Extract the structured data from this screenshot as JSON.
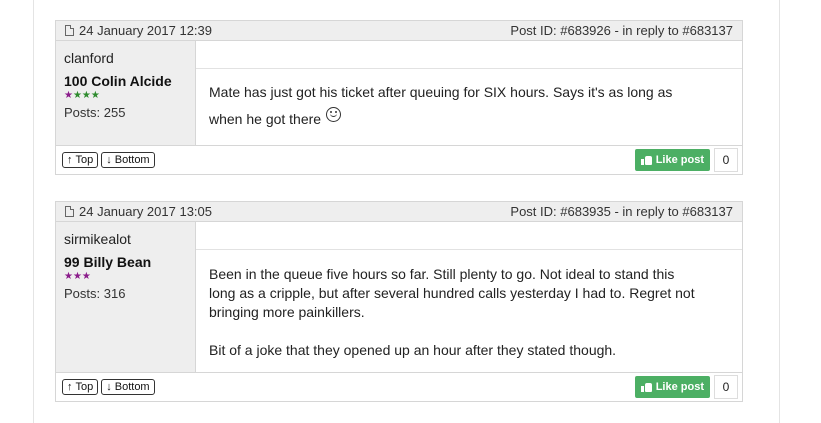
{
  "posts": [
    {
      "date": "24 January 2017 12:39",
      "post_ref": "Post ID: #683926 - in reply to #683137",
      "username": "clanford",
      "profile_name": "100 Colin Alcide",
      "stars": "★★★★",
      "posts_count": "Posts: 255",
      "message_lines": [
        "Mate has just got his ticket after queuing for SIX hours. Says it's as long as",
        "when he got there"
      ],
      "top_label": "Top",
      "bottom_label": "Bottom",
      "like_label": "Like post",
      "like_count": "0"
    },
    {
      "date": "24 January 2017 13:05",
      "post_ref": "Post ID: #683935 - in reply to #683137",
      "username": "sirmikealot",
      "profile_name": "99 Billy Bean",
      "stars": "★★★",
      "posts_count": "Posts: 316",
      "message_lines": [
        "Been in the queue five hours so far. Still plenty to go. Not ideal to stand this",
        "long as a cripple, but after several hundred calls yesterday I had to. Regret not",
        "bringing more painkillers.",
        "Bit of a joke that they opened up an hour after they stated though."
      ],
      "top_label": "Top",
      "bottom_label": "Bottom",
      "like_label": "Like post",
      "like_count": "0"
    }
  ],
  "colors": {
    "like_green": "#4caf64",
    "header_gray": "#eeeeee",
    "star_green": "#2e8b2e",
    "star_purple": "#8b1c8b"
  },
  "icons": [
    "document-icon",
    "up-arrow-icon",
    "down-arrow-icon",
    "thumbs-up-icon",
    "smiley-icon"
  ]
}
